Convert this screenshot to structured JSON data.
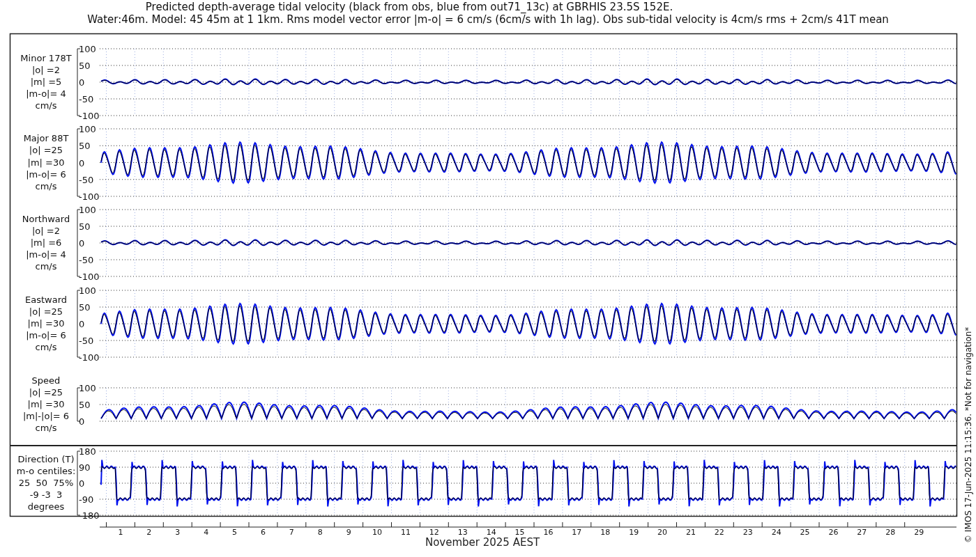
{
  "title": [
    "Predicted depth-average tidal velocity (black from obs, blue from out71_13c) at GBRHIS 23.5S 152E.",
    "Water:46m. Model: 45 45m at 1 1km. Rms model vector error |m-o| = 6 cm/s (6cm/s with 1h lag). Obs sub-tidal velocity is 4cm/s rms + 2cm/s 41T mean"
  ],
  "panels": [
    {
      "kind": "weak",
      "label": [
        "Minor 178T",
        "|o| =2",
        "|m| =5",
        "|m-o|= 4",
        "cm/s"
      ],
      "yticks": [
        "100",
        "50",
        "0",
        "-50",
        "-100"
      ]
    },
    {
      "kind": "strong",
      "label": [
        "Major 88T",
        "|o| =25",
        "|m| =30",
        "|m-o|= 6",
        "cm/s"
      ],
      "yticks": [
        "100",
        "50",
        "0",
        "-50",
        "-100"
      ]
    },
    {
      "kind": "weak",
      "label": [
        "Northward",
        "|o| =2",
        "|m| =6",
        "|m-o|= 4",
        "cm/s"
      ],
      "yticks": [
        "100",
        "50",
        "0",
        "-50",
        "-100"
      ]
    },
    {
      "kind": "strong",
      "label": [
        "Eastward",
        "|o| =25",
        "|m| =30",
        "|m-o|= 6",
        "cm/s"
      ],
      "yticks": [
        "100",
        "50",
        "0",
        "-50",
        "-100"
      ]
    },
    {
      "kind": "speed",
      "label": [
        "Speed",
        "|o| =25",
        "|m| =30",
        "|m|-|o|= 6",
        "cm/s"
      ],
      "yticks": [
        "100",
        "50",
        "0"
      ]
    },
    {
      "kind": "direction",
      "label": [
        "Direction (T)",
        "m-o centiles:",
        "25  50  75%",
        "-9 -3  3",
        "degrees"
      ],
      "yticks": [
        "180",
        "90",
        "0",
        "-90",
        "-180"
      ]
    }
  ],
  "days": [
    "1",
    "2",
    "3",
    "4",
    "5",
    "6",
    "7",
    "8",
    "9",
    "10",
    "11",
    "12",
    "13",
    "14",
    "15",
    "16",
    "17",
    "18",
    "19",
    "20",
    "21",
    "22",
    "23",
    "24",
    "25",
    "26",
    "27",
    "28",
    "29"
  ],
  "xlabel": "November 2025 AEST",
  "footer": "© IMOS 17-Jun-2025 11:15:36. *Not for navigation*"
}
